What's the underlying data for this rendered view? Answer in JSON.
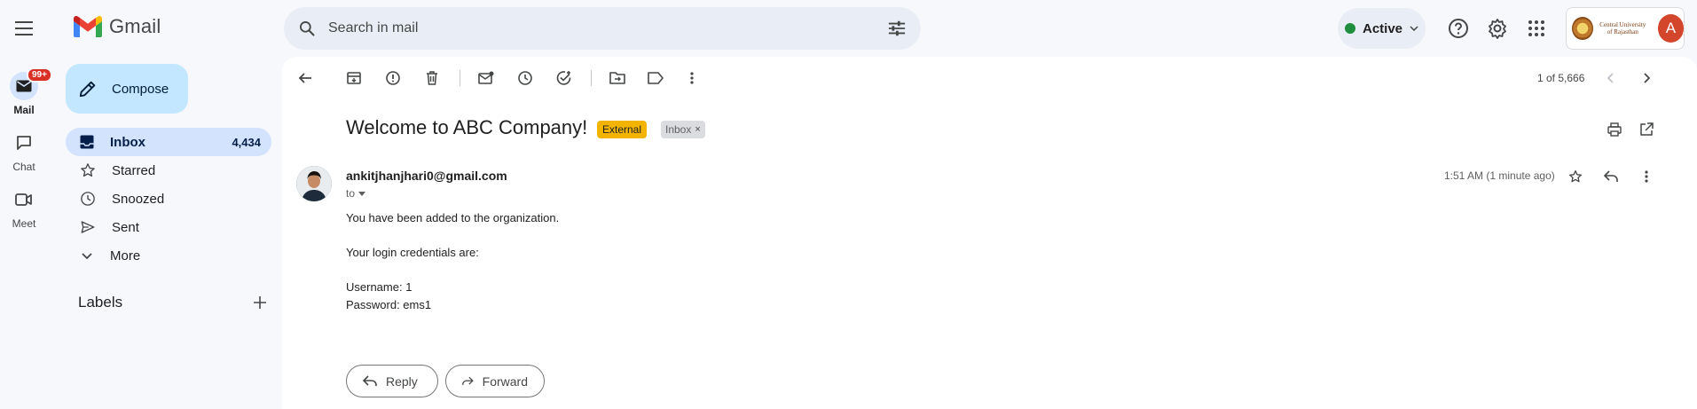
{
  "app": {
    "name": "Gmail"
  },
  "header": {
    "search_placeholder": "Search in mail",
    "status_label": "Active",
    "org_name": "Central University of Rajasthan",
    "account_initial": "A"
  },
  "rail": {
    "mail_label": "Mail",
    "mail_badge": "99+",
    "chat_label": "Chat",
    "meet_label": "Meet"
  },
  "nav": {
    "compose_label": "Compose",
    "items": [
      {
        "label": "Inbox",
        "count": "4,434",
        "icon": "inbox-icon",
        "active": true
      },
      {
        "label": "Starred",
        "count": "",
        "icon": "star-icon"
      },
      {
        "label": "Snoozed",
        "count": "",
        "icon": "clock-icon"
      },
      {
        "label": "Sent",
        "count": "",
        "icon": "send-icon"
      },
      {
        "label": "More",
        "count": "",
        "icon": "chevron-down-icon"
      }
    ],
    "labels_heading": "Labels"
  },
  "toolbar": {
    "pager": "1 of 5,666"
  },
  "message": {
    "subject": "Welcome to ABC Company!",
    "chips": {
      "external": "External",
      "inbox": "Inbox"
    },
    "sender": "ankitjhanjhari0@gmail.com",
    "to_label": "to",
    "time": "1:51 AM (1 minute ago)",
    "body": [
      "You have been added to the organization.",
      "Your login credentials are:",
      "Username: 1",
      "Password: ems1"
    ],
    "reply_label": "Reply",
    "forward_label": "Forward"
  },
  "colors": {
    "accent": "#c2e7ff",
    "active_nav": "#d3e3fd",
    "external_chip": "#f2b400",
    "badge": "#d93025",
    "status_dot": "#1e8e3e"
  }
}
